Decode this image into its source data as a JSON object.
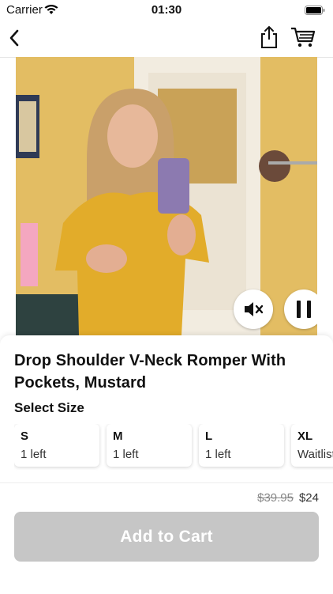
{
  "status": {
    "carrier": "Carrier",
    "time": "01:30"
  },
  "nav": {
    "back": "back",
    "share": "share",
    "cart": "cart"
  },
  "product": {
    "title": "Drop Shoulder V-Neck Romper With Pockets, Mustard",
    "select_size_label": "Select Size",
    "sizes": [
      {
        "code": "S",
        "stock": "1 left"
      },
      {
        "code": "M",
        "stock": "1 left"
      },
      {
        "code": "L",
        "stock": "1 left"
      },
      {
        "code": "XL",
        "stock": "Waitlist"
      }
    ],
    "price_original": "$39.95",
    "price_sale": "$24",
    "add_to_cart_label": "Add to Cart"
  },
  "icons": {
    "back": "chevron-left-icon",
    "share": "share-icon",
    "cart": "cart-icon",
    "mute": "speaker-mute-icon",
    "pause": "pause-icon"
  },
  "colors": {
    "button_disabled": "#c6c6c6",
    "video_background": "#e6c067"
  }
}
